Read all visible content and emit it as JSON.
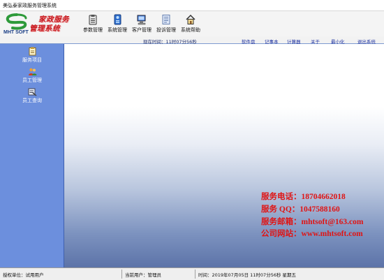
{
  "window": {
    "title": "美弘泰家政服务管理系统"
  },
  "branding": {
    "logo_text": "MHT SOFT",
    "line1": "家政服务",
    "line2": "管理系统"
  },
  "toolbar": [
    {
      "label": "参数管理",
      "icon": "clipboard-icon"
    },
    {
      "label": "系统管理",
      "icon": "system-icon"
    },
    {
      "label": "客户管理",
      "icon": "computer-icon"
    },
    {
      "label": "投诉管理",
      "icon": "document-icon"
    },
    {
      "label": "系统帮助",
      "icon": "house-icon"
    }
  ],
  "status_strip": {
    "clock": "现在时间：11时07分56秒",
    "links": [
      "软件盘",
      "记事本",
      "计算器",
      "关于",
      "最小化",
      "退出系统"
    ]
  },
  "sidebar": [
    {
      "label": "服务项目",
      "icon": "service-items-icon"
    },
    {
      "label": "员工管理",
      "icon": "staff-icon"
    },
    {
      "label": "员工查询",
      "icon": "staff-search-icon"
    }
  ],
  "contact": {
    "phone": "服务电话：18704662018",
    "qq": "服务 QQ：1047588160",
    "email": "服务邮箱：mhtsoft@163.com",
    "website": "公司网站：www.mhtsoft.com"
  },
  "footer": {
    "unit": "授权单位：试用用户",
    "user": "当前用户：管理员",
    "time": "时间：2019年07月05日 11时07分56秒  星期五"
  },
  "colors": {
    "sidebar": "#6c8fdd",
    "contact_text": "#e01414",
    "brand_text": "#c8181e"
  }
}
